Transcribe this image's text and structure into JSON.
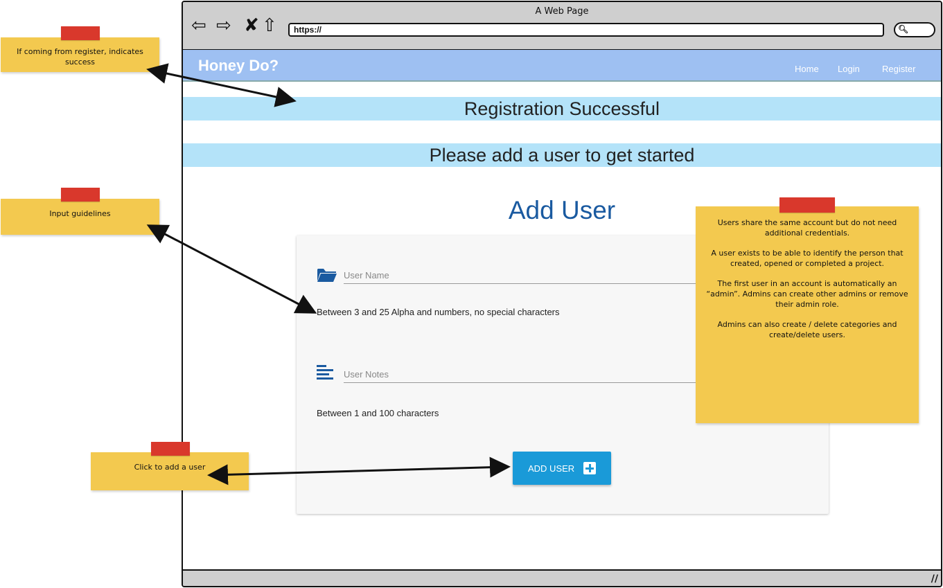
{
  "window": {
    "title": "A Web Page",
    "url": "https://"
  },
  "chrome_icons": [
    "back-arrow-icon",
    "forward-arrow-icon",
    "close-x-icon",
    "home-icon",
    "search-icon"
  ],
  "navbar": {
    "brand": "Honey Do?",
    "links": [
      "Home",
      "Login",
      "Register"
    ]
  },
  "banners": {
    "success": "Registration Successful",
    "prompt": "Please add a user to get started"
  },
  "form": {
    "title": "Add User",
    "user_name_placeholder": "User Name",
    "user_name_hint": "Between 3 and 25 Alpha and numbers, no special characters",
    "user_notes_placeholder": "User Notes",
    "user_notes_hint": "Between 1 and 100 characters",
    "submit_label": "ADD USER"
  },
  "notes": {
    "register": "If coming from register, indicates success",
    "guidelines": "Input guidelines",
    "add_user": "Click to add a user",
    "users_info": [
      "Users share the same account but do not need additional credentials.",
      "A user exists to be able to identify the person that created, opened or completed a project.",
      "The first user in an account is automatically an “admin”.  Admins can create other admins or remove their admin role.",
      "Admins can also create / delete categories and create/delete users."
    ]
  },
  "colors": {
    "navbar": "#9ec0f2",
    "banner": "#b4e3f9",
    "title": "#1a5aa0",
    "button": "#1a9ad8",
    "sticky": "#f3c94f",
    "tape": "#d9382c"
  }
}
